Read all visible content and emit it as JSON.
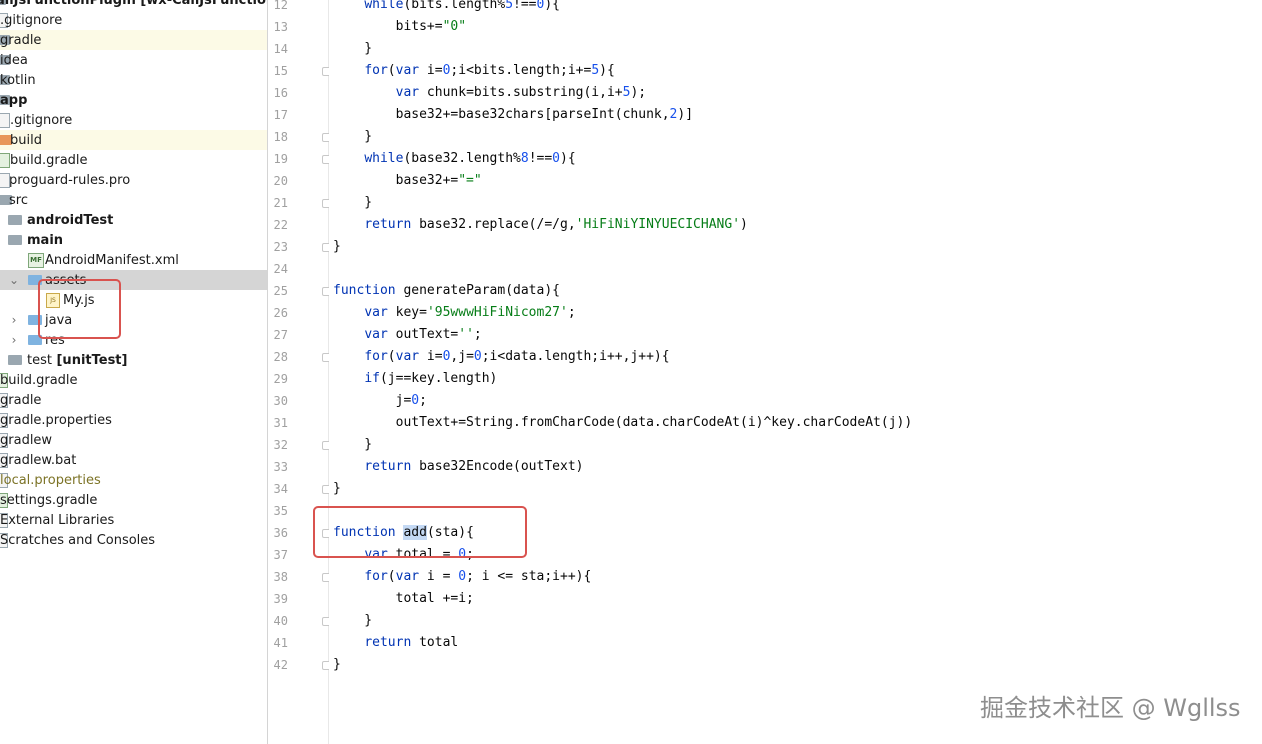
{
  "project_tree": [
    {
      "label": "allJsFunctionPlugin",
      "suffix": " [wx-CallJsFunction-Plugi",
      "icon": "folder-icon",
      "type": "root"
    },
    {
      "label": ".gitignore",
      "icon": "file-icon"
    },
    {
      "label": "gradle",
      "icon": "folder-icon",
      "style": "excluded"
    },
    {
      "label": "idea",
      "icon": "folder-icon"
    },
    {
      "label": "kotlin",
      "icon": "folder-icon"
    },
    {
      "label": "app",
      "icon": "folder-icon",
      "style": "bold"
    },
    {
      "label": ".gitignore",
      "icon": "file-icon"
    },
    {
      "label": "build",
      "icon": "folder-icon",
      "style": "excluded"
    },
    {
      "label": "build.gradle",
      "icon": "gradle-file-icon"
    },
    {
      "label": "proguard-rules.pro",
      "icon": "file-icon"
    },
    {
      "label": "src",
      "icon": "folder-icon"
    },
    {
      "label": "androidTest",
      "icon": "folder-icon",
      "style": "bold"
    },
    {
      "label": "main",
      "icon": "folder-icon",
      "style": "bold"
    },
    {
      "label": "AndroidManifest.xml",
      "icon": "manifest-file-icon"
    },
    {
      "label": "assets",
      "icon": "folder-icon",
      "style": "selected",
      "arrow": "expanded"
    },
    {
      "label": "My.js",
      "icon": "js-file-icon"
    },
    {
      "label": "java",
      "icon": "folder-icon",
      "arrow": "collapsed"
    },
    {
      "label": "res",
      "icon": "folder-icon",
      "arrow": "collapsed"
    },
    {
      "label": "test",
      "suffix": " [unitTest]",
      "icon": "folder-icon"
    },
    {
      "label": "build.gradle",
      "icon": "gradle-file-icon"
    },
    {
      "label": "gradle",
      "icon": "file-icon"
    },
    {
      "label": "gradle.properties",
      "icon": "file-icon"
    },
    {
      "label": "gradlew",
      "icon": "file-icon"
    },
    {
      "label": "gradlew.bat",
      "icon": "file-icon"
    },
    {
      "label": "local.properties",
      "icon": "file-icon",
      "style": "olive"
    },
    {
      "label": "settings.gradle",
      "icon": "gradle-file-icon"
    },
    {
      "label": "External Libraries",
      "icon": "library-icon"
    },
    {
      "label": "Scratches and Consoles",
      "icon": "scratch-icon"
    }
  ],
  "editor": {
    "current_line": 36,
    "lines": [
      {
        "n": "12",
        "text": "    while(bits.length%5!==0){"
      },
      {
        "n": "13",
        "text": "        bits+=\"0\""
      },
      {
        "n": "14",
        "text": "    }"
      },
      {
        "n": "15",
        "text": "    for(var i=0;i<bits.length;i+=5){"
      },
      {
        "n": "16",
        "text": "        var chunk=bits.substring(i,i+5);"
      },
      {
        "n": "17",
        "text": "        base32+=base32chars[parseInt(chunk,2)]"
      },
      {
        "n": "18",
        "text": "    }"
      },
      {
        "n": "19",
        "text": "    while(base32.length%8!==0){"
      },
      {
        "n": "20",
        "text": "        base32+=\"=\""
      },
      {
        "n": "21",
        "text": "    }"
      },
      {
        "n": "22",
        "text": "    return base32.replace(/=/g,'HiFiNiYINYUECICHANG')"
      },
      {
        "n": "23",
        "text": "}"
      },
      {
        "n": "24",
        "text": ""
      },
      {
        "n": "25",
        "text": "function generateParam(data){"
      },
      {
        "n": "26",
        "text": "    var key='95wwwHiFiNicom27';"
      },
      {
        "n": "27",
        "text": "    var outText='';"
      },
      {
        "n": "28",
        "text": "    for(var i=0,j=0;i<data.length;i++,j++){"
      },
      {
        "n": "29",
        "text": "    if(j==key.length)"
      },
      {
        "n": "30",
        "text": "        j=0;"
      },
      {
        "n": "31",
        "text": "        outText+=String.fromCharCode(data.charCodeAt(i)^key.charCodeAt(j))"
      },
      {
        "n": "32",
        "text": "    }"
      },
      {
        "n": "33",
        "text": "    return base32Encode(outText)"
      },
      {
        "n": "34",
        "text": "}"
      },
      {
        "n": "35",
        "text": ""
      },
      {
        "n": "36",
        "text": "function add(sta){"
      },
      {
        "n": "37",
        "text": "    var total = 0;"
      },
      {
        "n": "38",
        "text": "    for(var i = 0; i <= sta;i++){"
      },
      {
        "n": "39",
        "text": "        total +=i;"
      },
      {
        "n": "40",
        "text": "    }"
      },
      {
        "n": "41",
        "text": "    return total"
      },
      {
        "n": "42",
        "text": "}"
      }
    ]
  },
  "watermark": "掘金技术社区 @ Wgllss",
  "colors": {
    "keyword": "#0033b3",
    "string": "#067d17",
    "number": "#1750eb",
    "annotation_box": "#d9534f",
    "selected_row": "#d5d5d5"
  }
}
